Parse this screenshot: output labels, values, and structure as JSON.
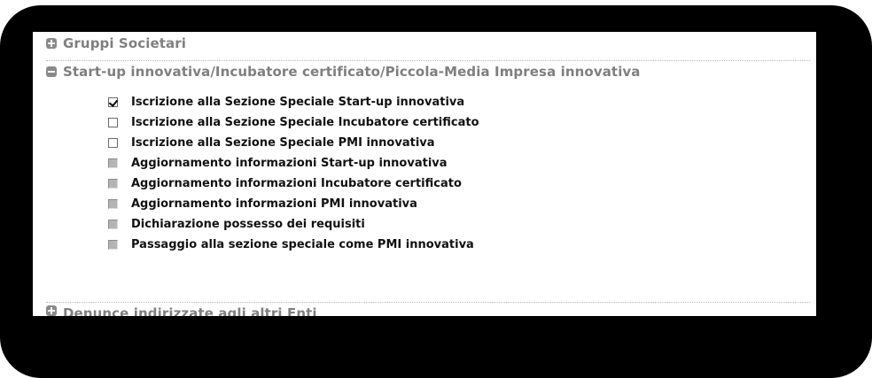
{
  "sections": {
    "top": {
      "label": "Gruppi Societari",
      "expanded": false
    },
    "main": {
      "label": "Start-up innovativa/Incubatore certificato/Piccola-Media Impresa innovativa",
      "expanded": true
    },
    "bottom": {
      "label": "Denunce indirizzate agli altri Enti",
      "expanded": false
    }
  },
  "options": [
    {
      "label": "Iscrizione alla Sezione Speciale Start-up innovativa",
      "checked": true,
      "enabled": true
    },
    {
      "label": "Iscrizione alla Sezione Speciale Incubatore certificato",
      "checked": false,
      "enabled": true
    },
    {
      "label": "Iscrizione alla Sezione Speciale PMI innovativa",
      "checked": false,
      "enabled": true
    },
    {
      "label": "Aggiornamento informazioni Start-up innovativa",
      "checked": false,
      "enabled": false
    },
    {
      "label": "Aggiornamento informazioni Incubatore certificato",
      "checked": false,
      "enabled": false
    },
    {
      "label": "Aggiornamento informazioni PMI innovativa",
      "checked": false,
      "enabled": false
    },
    {
      "label": "Dichiarazione possesso dei requisiti",
      "checked": false,
      "enabled": false
    },
    {
      "label": "Passaggio alla sezione speciale come PMI innovativa",
      "checked": false,
      "enabled": false
    }
  ]
}
